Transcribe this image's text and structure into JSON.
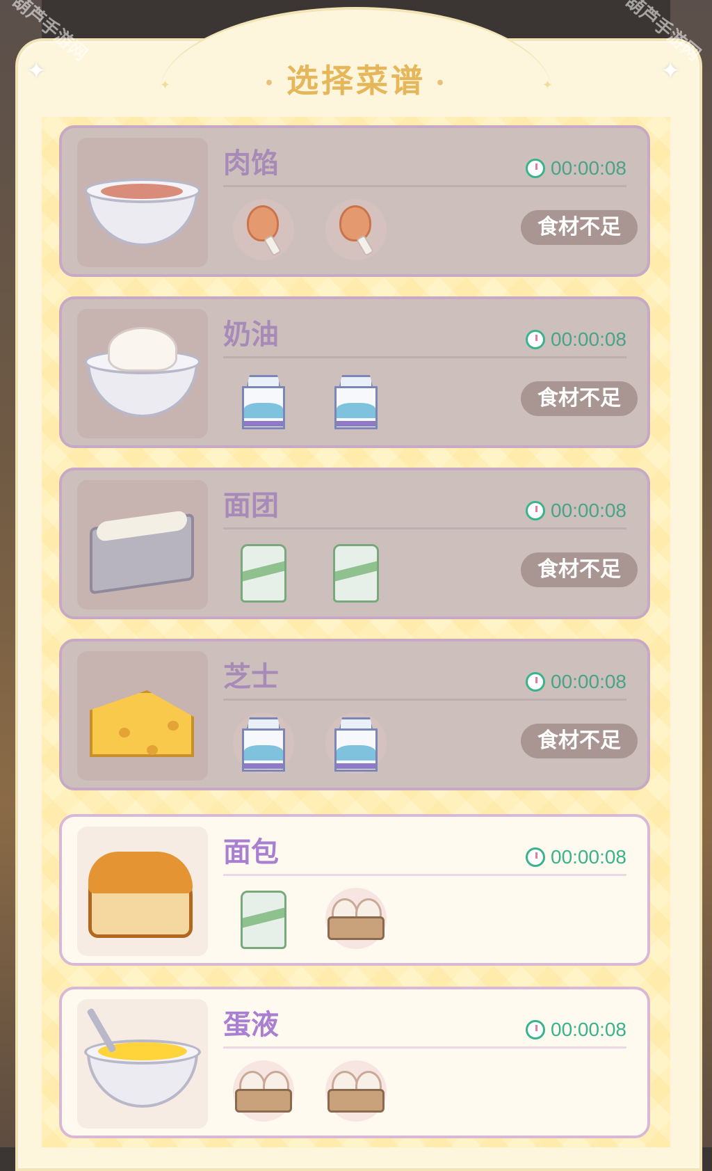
{
  "header": {
    "title": "选择菜谱"
  },
  "watermark": "葫芦手游网",
  "recipes": [
    {
      "name": "肉馅",
      "time": "00:00:08",
      "status": "食材不足",
      "locked": true,
      "dish_icon": "meat-filling-bowl-icon",
      "ingredients": [
        "drumstick-icon",
        "drumstick-icon"
      ]
    },
    {
      "name": "奶油",
      "time": "00:00:08",
      "status": "食材不足",
      "locked": true,
      "dish_icon": "cream-bowl-icon",
      "ingredients": [
        "milk-carton-icon",
        "milk-carton-icon"
      ]
    },
    {
      "name": "面团",
      "time": "00:00:08",
      "status": "食材不足",
      "locked": true,
      "dish_icon": "dough-tin-icon",
      "ingredients": [
        "flour-sack-icon",
        "flour-sack-icon"
      ]
    },
    {
      "name": "芝士",
      "time": "00:00:08",
      "status": "食材不足",
      "locked": true,
      "dish_icon": "cheese-icon",
      "ingredients": [
        "milk-carton-icon",
        "milk-carton-icon"
      ]
    },
    {
      "name": "面包",
      "time": "00:00:08",
      "status": "",
      "locked": false,
      "dish_icon": "bread-loaf-icon",
      "ingredients": [
        "flour-sack-icon",
        "egg-tray-icon"
      ]
    },
    {
      "name": "蛋液",
      "time": "00:00:08",
      "status": "",
      "locked": false,
      "dish_icon": "egg-liquid-bowl-icon",
      "ingredients": [
        "egg-tray-icon",
        "egg-tray-icon"
      ]
    }
  ],
  "colors": {
    "timer": "#3ab28c",
    "name": "#a97fd1",
    "title": "#e6b75a",
    "status_button": "#a99591"
  }
}
